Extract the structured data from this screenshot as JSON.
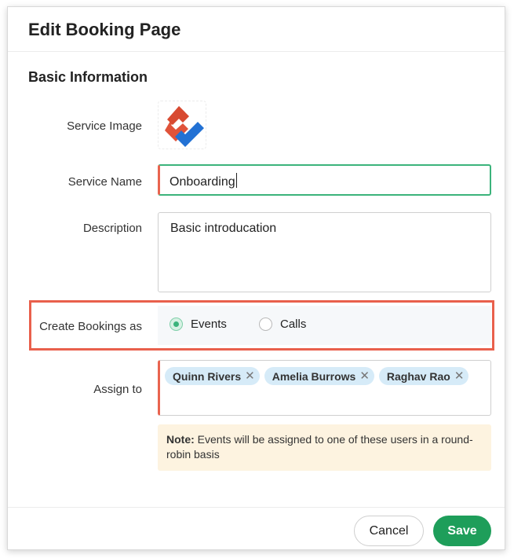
{
  "dialog": {
    "title": "Edit Booking Page",
    "section_title": "Basic Information"
  },
  "form": {
    "service_image_label": "Service Image",
    "service_image_icon": "zoho-bookings-logo-icon",
    "service_name_label": "Service Name",
    "service_name_value": "Onboarding",
    "description_label": "Description",
    "description_value": "Basic introducation",
    "create_bookings_label": "Create Bookings as",
    "booking_options": [
      {
        "label": "Events",
        "selected": true
      },
      {
        "label": "Calls",
        "selected": false
      }
    ],
    "assign_label": "Assign to",
    "assignees": [
      "Quinn Rivers",
      "Amelia Burrows",
      "Raghav Rao"
    ],
    "note_prefix": "Note:",
    "note_text": " Events will be assigned to one of these users in a round-robin basis"
  },
  "footer": {
    "cancel_label": "Cancel",
    "save_label": "Save"
  },
  "colors": {
    "accent_green": "#1e9e5a",
    "focus_green": "#3bb37b",
    "required_red": "#e9644f",
    "highlight_red": "#e9604c",
    "chip_blue": "#d6ebf8",
    "note_bg": "#fdf3e0"
  }
}
